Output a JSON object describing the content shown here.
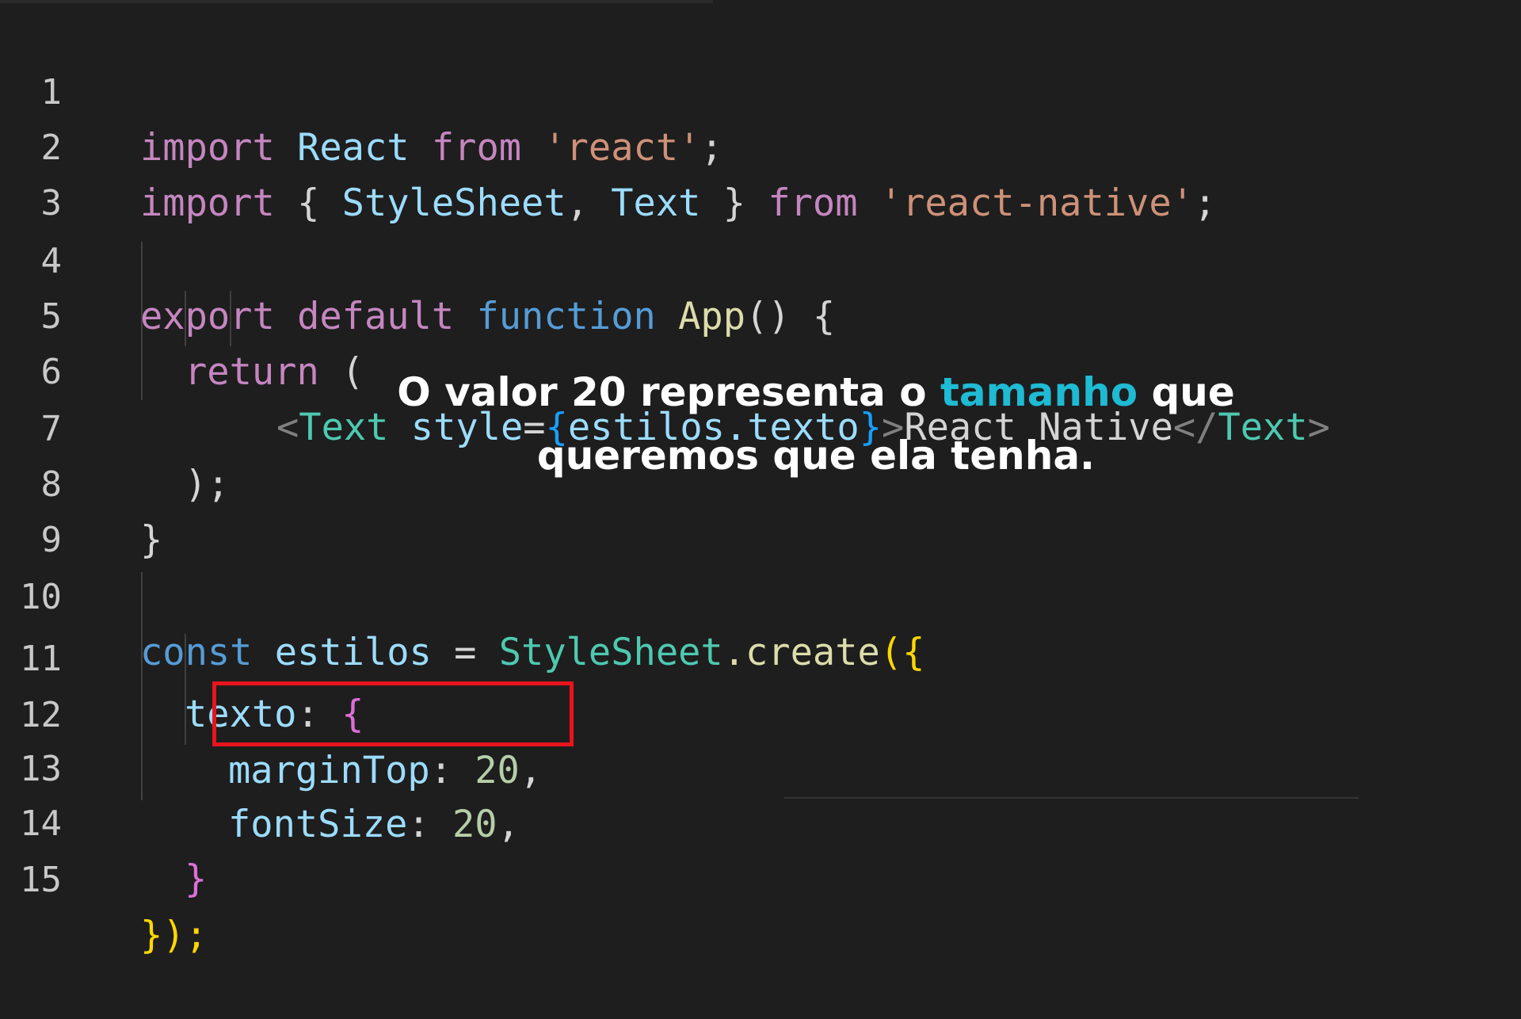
{
  "editor": {
    "lines": [
      {
        "n": "1"
      },
      {
        "n": "2"
      },
      {
        "n": "3"
      },
      {
        "n": "4"
      },
      {
        "n": "5"
      },
      {
        "n": "6"
      },
      {
        "n": "7"
      },
      {
        "n": "8"
      },
      {
        "n": "9"
      },
      {
        "n": "10"
      },
      {
        "n": "11"
      },
      {
        "n": "12"
      },
      {
        "n": "13"
      },
      {
        "n": "14"
      },
      {
        "n": "15"
      }
    ],
    "tokens": {
      "import": "import",
      "react_ident": "React",
      "from": "from",
      "react_str": "'react'",
      "semi": ";",
      "open_brace": "{",
      "stylesheet": "StyleSheet",
      "comma": ",",
      "text": "Text",
      "close_brace": "}",
      "rn_str": "'react-native'",
      "export": "export",
      "default": "default",
      "function": "function",
      "app": "App",
      "parens": "()",
      "return": "return",
      "open_paren": "(",
      "lt": "<",
      "style": "style",
      "eq": "=",
      "estilos_texto": "estilos.texto",
      "gt": ">",
      "react_native_text": "React Native",
      "close_tag_open": "</",
      "close_paren_semi": ");",
      "const": "const",
      "estilos": "estilos",
      "assign": "=",
      "dot_create": ".create",
      "paren_brace": "({",
      "texto": "texto",
      "colon": ":",
      "margin_top": "marginTop",
      "font_size": "fontSize",
      "val20": "20",
      "end": "});"
    }
  },
  "caption": {
    "part1": "O valor 20 representa o ",
    "accent": "tamanho",
    "part2": " que",
    "line2": "queremos que ela tenha."
  },
  "colors": {
    "background": "#1e1e1e",
    "highlight": "#e8141c",
    "accent": "#1fbad3"
  }
}
